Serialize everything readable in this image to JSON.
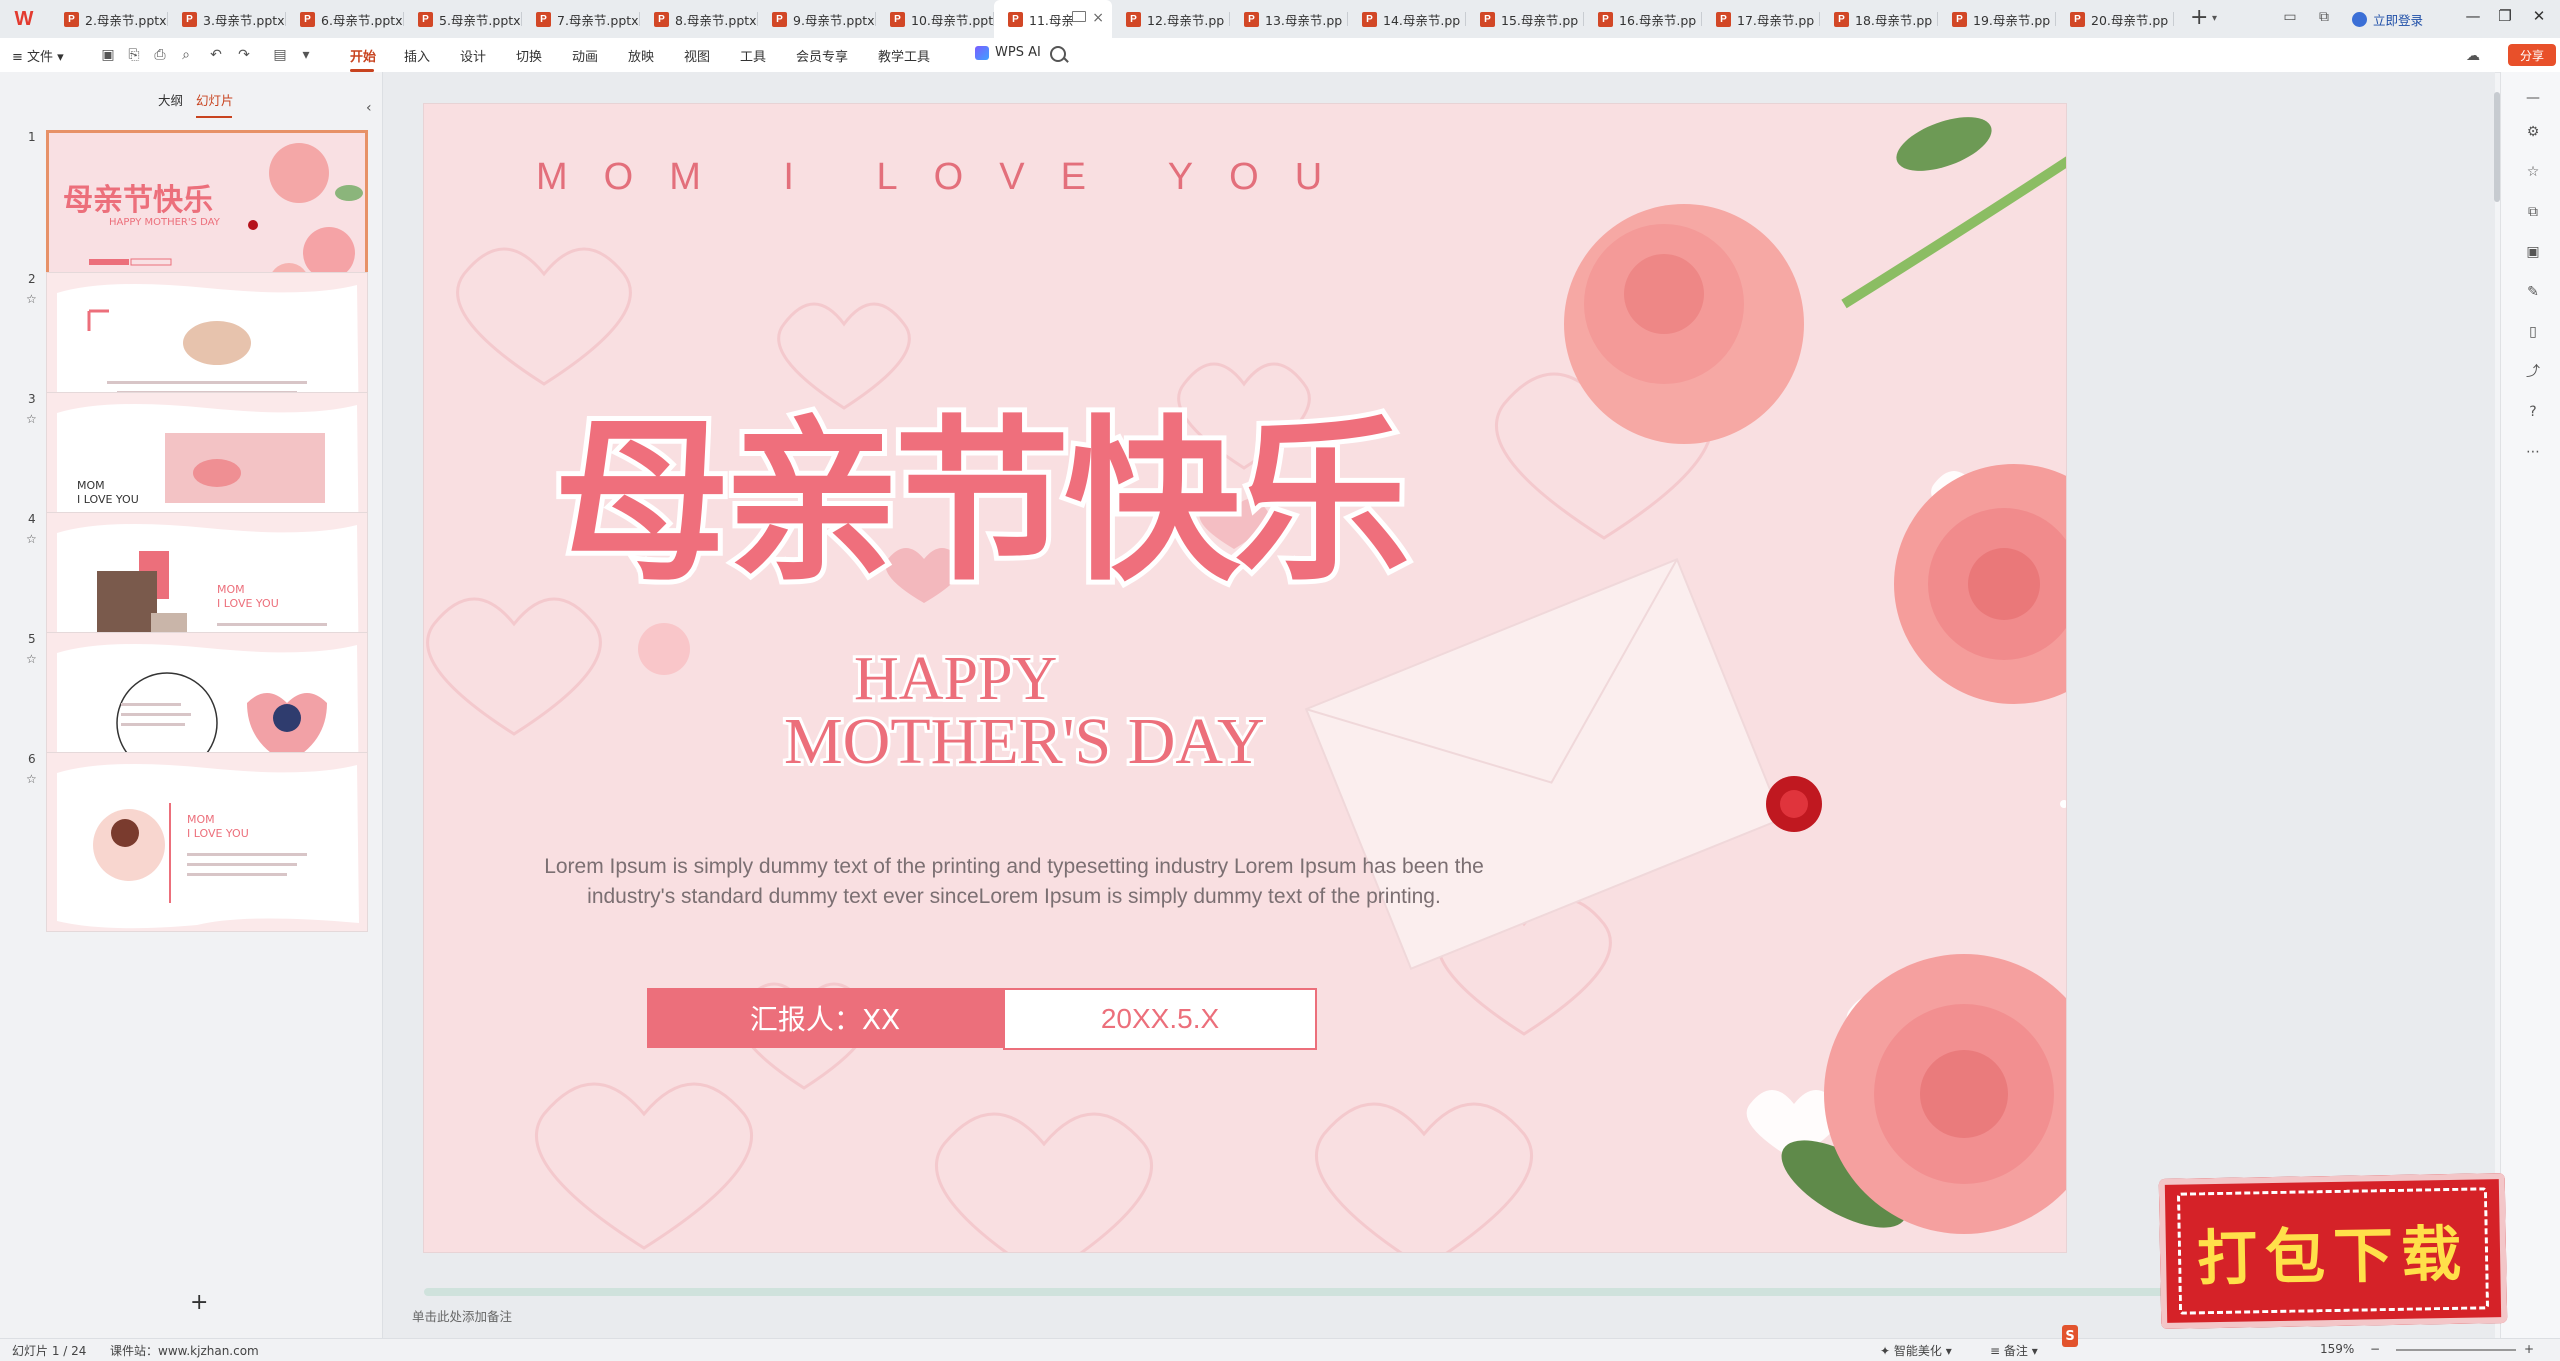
{
  "colors": {
    "accent": "#c8431f",
    "slide_pink": "#ec6f7b",
    "slide_bg": "#f9dfe1",
    "watermark_red": "#d52228"
  },
  "tabs": [
    {
      "label": "2.母亲节.pptx"
    },
    {
      "label": "3.母亲节.pptx"
    },
    {
      "label": "6.母亲节.pptx"
    },
    {
      "label": "5.母亲节.pptx"
    },
    {
      "label": "7.母亲节.pptx"
    },
    {
      "label": "8.母亲节.pptx"
    },
    {
      "label": "9.母亲节.pptx"
    },
    {
      "label": "10.母亲节.ppt"
    },
    {
      "label": "11.母亲"
    },
    {
      "label": "12.母亲节.pp"
    },
    {
      "label": "13.母亲节.pp"
    },
    {
      "label": "14.母亲节.pp"
    },
    {
      "label": "15.母亲节.pp"
    },
    {
      "label": "16.母亲节.pp"
    },
    {
      "label": "17.母亲节.pp"
    },
    {
      "label": "18.母亲节.pp"
    },
    {
      "label": "19.母亲节.pp"
    },
    {
      "label": "20.母亲节.pp"
    }
  ],
  "titlebar": {
    "login_label": "立即登录",
    "share_label": "分享"
  },
  "menu": {
    "file_label": "文件",
    "items": [
      "开始",
      "插入",
      "设计",
      "切换",
      "动画",
      "放映",
      "视图",
      "工具",
      "会员专享",
      "教学工具"
    ],
    "wps_ai_label": "WPS AI"
  },
  "leftpanel": {
    "tab_outline": "大纲",
    "tab_slides": "幻灯片",
    "thumbs": [
      {
        "num": "1"
      },
      {
        "num": "2"
      },
      {
        "num": "3"
      },
      {
        "num": "4"
      },
      {
        "num": "5"
      },
      {
        "num": "6"
      }
    ],
    "add_label": "+"
  },
  "slide": {
    "en_heading": "MOM I LOVE YOU",
    "cn_title": "母亲节快乐",
    "en_title_1": "HAPPY",
    "en_title_2": "MOTHER'S DAY",
    "body": "Lorem Ipsum is simply dummy text of the printing and typesetting industry Lorem Ipsum has been the industry's standard dummy text ever sinceLorem Ipsum is simply dummy text of the printing.",
    "reporter": "汇报人：XX",
    "date": "20XX.5.X"
  },
  "thumb_texts": {
    "t1_cn": "母亲节快乐",
    "t1_en": "HAPPY MOTHER'S DAY",
    "t3_mom": "MOM",
    "t3_love": "I LOVE YOU",
    "t4_mom": "MOM",
    "t4_love": "I LOVE YOU",
    "t6_mom": "MOM",
    "t6_love": "I LOVE YOU"
  },
  "notes_placeholder": "单击此处添加备注",
  "status": {
    "slide_count": "幻灯片 1 / 24",
    "site": "课件站：www.kjzhan.com",
    "beautify": "智能美化",
    "notes": "备注",
    "zoom": "159%"
  },
  "watermark": {
    "text": "打包下载"
  }
}
